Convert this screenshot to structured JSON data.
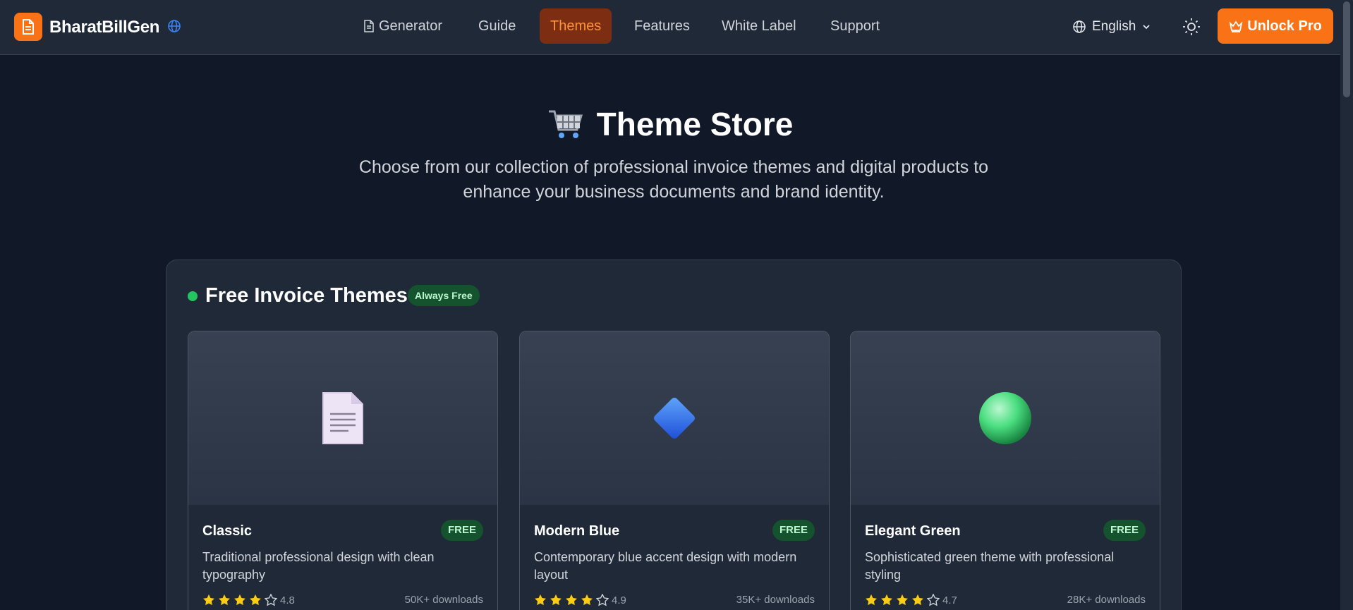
{
  "header": {
    "brand": "BharatBillGen",
    "nav": [
      {
        "label": "Generator"
      },
      {
        "label": "Guide"
      },
      {
        "label": "Themes",
        "active": true
      },
      {
        "label": "Features"
      },
      {
        "label": "White Label"
      },
      {
        "label": "Support"
      }
    ],
    "language": "English",
    "unlock_label": "Unlock Pro"
  },
  "hero": {
    "title": "Theme Store",
    "subtitle": "Choose from our collection of professional invoice themes and digital products to enhance your business documents and brand identity."
  },
  "section": {
    "title": "Free Invoice Themes",
    "badge": "Always Free"
  },
  "cards": [
    {
      "name": "Classic",
      "badge": "FREE",
      "description": "Traditional professional design with clean typography",
      "rating": "4.8",
      "stars_filled": 4,
      "downloads": "50K+ downloads",
      "icon": "document-icon"
    },
    {
      "name": "Modern Blue",
      "badge": "FREE",
      "description": "Contemporary blue accent design with modern layout",
      "rating": "4.9",
      "stars_filled": 4,
      "downloads": "35K+ downloads",
      "icon": "blue-diamond-icon"
    },
    {
      "name": "Elegant Green",
      "badge": "FREE",
      "description": "Sophisticated green theme with professional styling",
      "rating": "4.7",
      "stars_filled": 4,
      "downloads": "28K+ downloads",
      "icon": "green-circle-icon"
    }
  ],
  "colors": {
    "background": "#111827",
    "header": "#1f2937",
    "accent": "#f97316",
    "free_badge": "#14532d",
    "star": "#facc15"
  }
}
